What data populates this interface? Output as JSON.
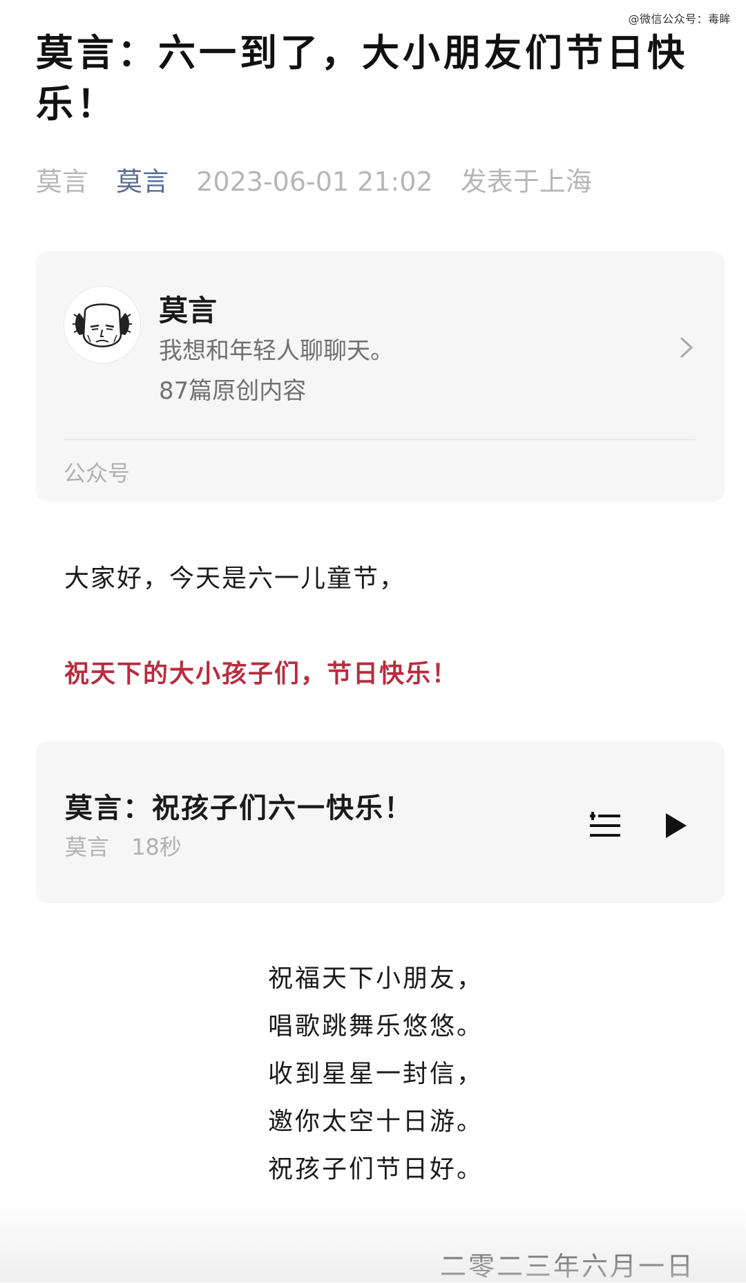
{
  "watermark": "@微信公众号：毒眸",
  "article": {
    "title": "莫言：六一到了，大小朋友们节日快乐！",
    "meta": {
      "author": "莫言",
      "account": "莫言",
      "datetime": "2023-06-01 21:02",
      "location": "发表于上海"
    }
  },
  "profile_card": {
    "name": "莫言",
    "description": "我想和年轻人聊聊天。",
    "original_count": "87篇原创内容",
    "type_label": "公众号",
    "avatar_icon": "avatar-caricature",
    "arrow_icon": "chevron-right-icon"
  },
  "body": {
    "greeting": "大家好，今天是六一儿童节，",
    "wish": "祝天下的大小孩子们，节日快乐！",
    "wish_color": "#b92c3e"
  },
  "audio_card": {
    "title": "莫言：祝孩子们六一快乐！",
    "author": "莫言",
    "duration": "18秒",
    "list_icon": "playlist-add-icon",
    "play_icon": "play-icon"
  },
  "poem": {
    "lines": [
      "祝福天下小朋友，",
      "唱歌跳舞乐悠悠。",
      "收到星星一封信，",
      "邀你太空十日游。",
      "祝孩子们节日好。"
    ]
  },
  "signature_date": "二零二三年六月一日"
}
